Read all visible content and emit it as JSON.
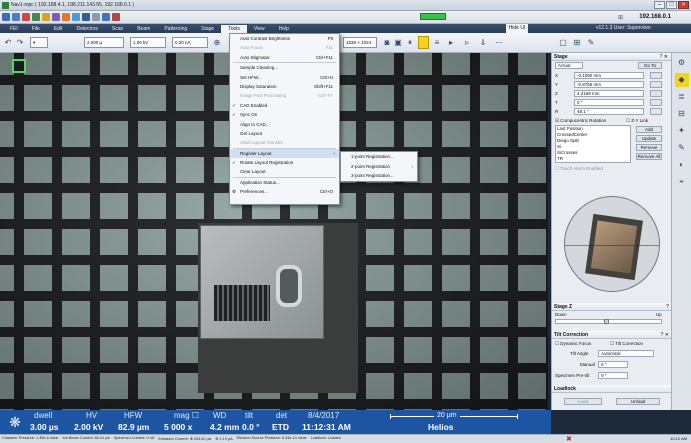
{
  "window": {
    "title": "Nav1-mpc ( 192.168.4.1, 198.211.143.65, 192.168.0.1 )",
    "ip_display": "192.168.0.1"
  },
  "menubar": {
    "items": [
      "FEI",
      "File",
      "Edit",
      "Detectors",
      "Scan",
      "Beam",
      "Patterning",
      "Stage",
      "Tools",
      "View",
      "Help"
    ],
    "active": "Tools",
    "user_tab": "Hide UI",
    "user_text": "v12.1.3   User: Supervisor"
  },
  "toolbar2": {
    "hfw_value": "2.000 µ",
    "voltage_value": "1.00 kV",
    "current_value": "0.20 nA",
    "resolution_value": "1536 × 1024"
  },
  "tools_menu": {
    "rows": [
      {
        "label": "Auto Contrast Brightness",
        "shortcut": "F9",
        "disabled": false,
        "checked": false
      },
      {
        "label": "Auto Focus",
        "shortcut": "F11",
        "disabled": true,
        "checked": false
      },
      {
        "label": "Auto Stigmator",
        "shortcut": "Ctrl+F11",
        "disabled": false,
        "checked": false
      },
      {
        "label": "Sample Cleaning...",
        "shortcut": "",
        "disabled": false,
        "checked": false
      },
      {
        "label": "Set HFW...",
        "shortcut": "Ctrl+H",
        "disabled": false,
        "checked": false
      },
      {
        "label": "Display Saturation",
        "shortcut": "Shift+F11",
        "disabled": false,
        "checked": false
      },
      {
        "label": "Image Post Processing",
        "shortcut": "Ctrl+F7",
        "disabled": true,
        "checked": false
      },
      {
        "label": "CAD Enabled",
        "shortcut": "",
        "disabled": false,
        "checked": true
      },
      {
        "label": "Sync On",
        "shortcut": "",
        "disabled": false,
        "checked": true
      },
      {
        "label": "Align to CAD...",
        "shortcut": "",
        "disabled": false,
        "checked": false
      },
      {
        "label": "Get Layout",
        "shortcut": "",
        "disabled": false,
        "checked": false
      },
      {
        "label": "Abort Layout Transfer",
        "shortcut": "",
        "disabled": true,
        "checked": false
      },
      {
        "label": "Register Layout",
        "shortcut": "",
        "disabled": false,
        "checked": false,
        "submenu": true
      },
      {
        "label": "Rotate Layout Registration",
        "shortcut": "",
        "disabled": false,
        "checked": true
      },
      {
        "label": "Clear Layout",
        "shortcut": "",
        "disabled": false,
        "checked": false
      },
      {
        "label": "Application Status...",
        "shortcut": "",
        "disabled": false,
        "checked": false
      },
      {
        "label": "Preferences...",
        "shortcut": "Ctrl+O",
        "disabled": false,
        "checked": false
      }
    ]
  },
  "register_submenu": {
    "rows": [
      "1-point Registration...",
      "2-point Registration",
      "3-point Registration..."
    ]
  },
  "stage_panel": {
    "title": "Stage",
    "mode": "Actual",
    "go_to": "Go To",
    "axes": [
      {
        "label": "X",
        "value": "-0.1090 mm"
      },
      {
        "label": "Y",
        "value": "-0.8765 mm"
      },
      {
        "label": "Z",
        "value": "4.2169 mm"
      },
      {
        "label": "T",
        "value": "0 °"
      },
      {
        "label": "R",
        "value": "48.1 °"
      }
    ],
    "compucentric": "Compucentric Rotation",
    "z_link": "Z-Y Link",
    "positions": [
      "Last Position",
      "CrossedCenter",
      "Diego Split",
      "Si",
      "SiCrosses",
      "TR"
    ],
    "buttons": [
      "Add",
      "Update",
      "Remove",
      "Remove All"
    ],
    "touch_alarm": "Touch Alarm Enabled"
  },
  "stage_z": {
    "title": "Stage Z",
    "down": "Down",
    "up": "Up"
  },
  "tilt_correction": {
    "title": "Tilt Correction",
    "dynamic_focus": "Dynamic Focus",
    "tilt_correction": "Tilt Correction",
    "tilt_angle_label": "Tilt Angle",
    "tilt_angle_value": "Automatic",
    "manual_label": "Manual",
    "manual_value": "0 °",
    "specimen_pre_tilt_label": "Specimen Pre-tilt",
    "specimen_pre_tilt_value": "0 °"
  },
  "loadlock": {
    "title": "Loadlock",
    "load": "Load",
    "unload": "Unload"
  },
  "databar": {
    "labels": [
      "dwell",
      "HV",
      "HFW",
      "mag ☐",
      "WD",
      "tilt",
      "det",
      "8/4/2017"
    ],
    "values": [
      "3.00 µs",
      "2.00 kV",
      "82.9 µm",
      "5 000 x",
      "4.2 mm",
      "0.0 °",
      "ETD",
      "11:12:31 AM"
    ],
    "scale": "20 µm",
    "instrument": "Helios"
  },
  "statusbar": {
    "items": [
      "Chamber Pressure: 1.39e-6 mbar",
      "Ion Beam Current: 80.41 pA",
      "Specimen Current: 0 nA",
      "Emission Current: ⊕ 203.62 µA",
      "⊕ 1.19 µA",
      "Electron Source Pressure: 5.34e-10 mbar",
      "Loadlock: Loaded"
    ],
    "time": "10:12 AM"
  },
  "colors": {
    "databar": "#1e55a3",
    "menubar": "#2a3c58",
    "status_ok": "#38c247",
    "toolbar_highlight": "#f5d21e"
  }
}
